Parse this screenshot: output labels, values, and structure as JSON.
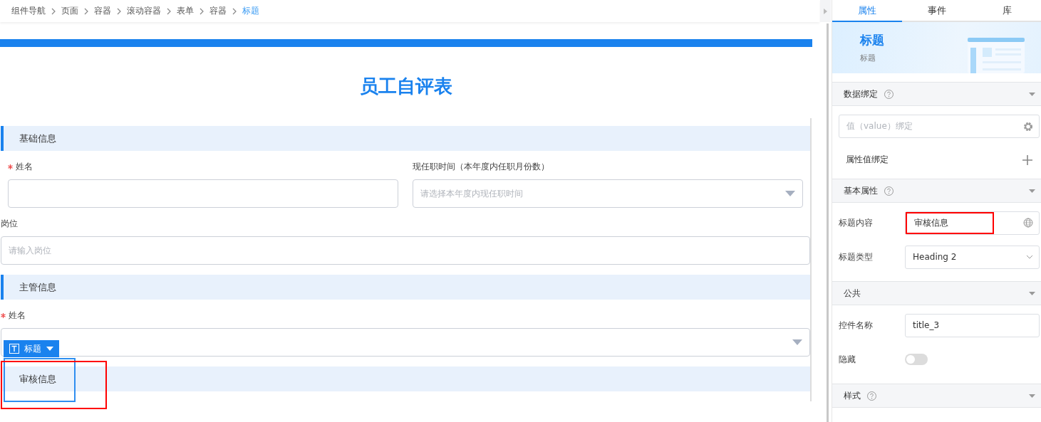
{
  "breadcrumb": [
    {
      "label": "组件导航",
      "selected": false
    },
    {
      "label": "页面",
      "selected": false
    },
    {
      "label": "容器",
      "selected": false
    },
    {
      "label": "滚动容器",
      "selected": false
    },
    {
      "label": "表单",
      "selected": false
    },
    {
      "label": "容器",
      "selected": false
    },
    {
      "label": "标题",
      "selected": true
    }
  ],
  "form": {
    "title": "员工自评表",
    "sections": [
      {
        "title": "基础信息",
        "selected": false,
        "rows": [
          {
            "fields": [
              {
                "kind": "input",
                "label": "姓名",
                "required": true
              },
              {
                "kind": "select",
                "label": "现任职时间（本年度内任职月份数）",
                "required": false,
                "placeholder": "请选择本年度内现任职时间"
              }
            ]
          },
          {
            "fields": [
              {
                "kind": "input",
                "label": "岗位",
                "required": false,
                "placeholder": "请输入岗位"
              }
            ]
          }
        ]
      },
      {
        "title": "主管信息",
        "selected": false,
        "rows": [
          {
            "fields": [
              {
                "kind": "select",
                "label": "姓名",
                "required": true
              }
            ]
          }
        ]
      },
      {
        "title": "审核信息",
        "selected": true
      }
    ]
  },
  "selection_tag": {
    "label": "标题"
  },
  "panel": {
    "tabs": [
      {
        "label": "属性",
        "selected": true
      },
      {
        "label": "事件",
        "selected": false
      },
      {
        "label": "库",
        "selected": false
      }
    ],
    "header": {
      "title": "标题",
      "subtitle": "标题"
    },
    "groups": [
      {
        "title": "数据绑定",
        "help": true,
        "rows": [
          {
            "kind": "binding",
            "placeholder": "值（value）绑定"
          },
          {
            "kind": "add",
            "label": "属性值绑定"
          }
        ]
      },
      {
        "title": "基本属性",
        "help": true,
        "rows": [
          {
            "kind": "text",
            "label": "标题内容",
            "value": "审核信息",
            "highlighted": true
          },
          {
            "kind": "select",
            "label": "标题类型",
            "value": "Heading 2"
          }
        ]
      },
      {
        "title": "公共",
        "help": false,
        "rows": [
          {
            "kind": "text",
            "label": "控件名称",
            "value": "title_3",
            "highlighted": false
          },
          {
            "kind": "toggle",
            "label": "隐藏",
            "on": false
          }
        ]
      },
      {
        "title": "样式",
        "help": true
      }
    ]
  }
}
